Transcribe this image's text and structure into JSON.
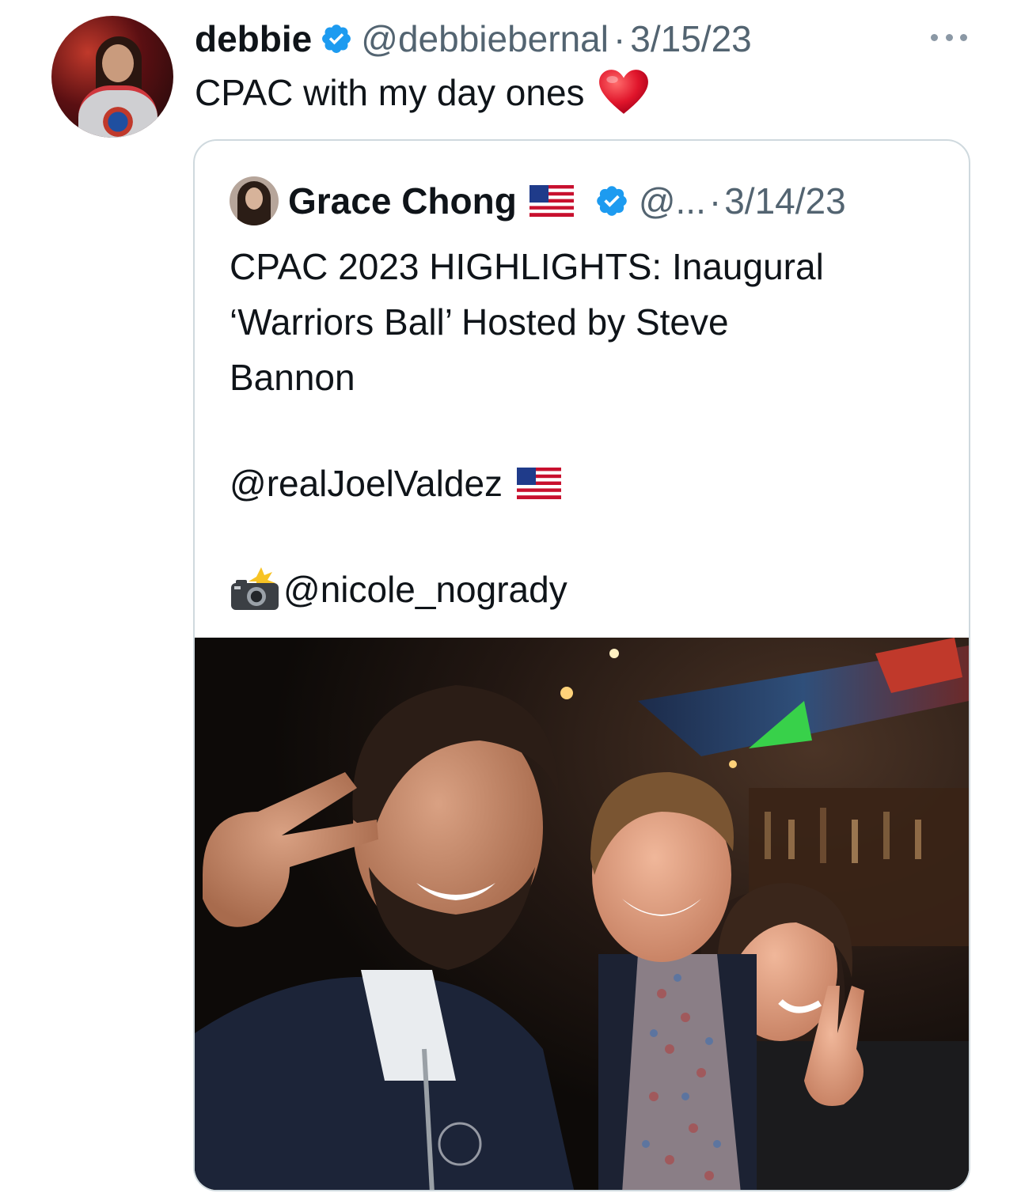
{
  "tweet": {
    "display_name": "debbie",
    "handle": "@debbiebernal",
    "separator": "·",
    "timestamp": "3/15/23",
    "text": "CPAC with my day ones",
    "emoji": "heart-icon",
    "verified": true,
    "more_menu": "more-options-icon"
  },
  "quoted_tweet": {
    "display_name": "Grace Chong",
    "name_emoji": "us-flag-icon",
    "verified": true,
    "handle": "@...",
    "separator": "·",
    "timestamp": "3/14/23",
    "body_lines": [
      "CPAC 2023 HIGHLIGHTS: Inaugural",
      "‘Warriors Ball’ Hosted by Steve",
      "Bannon"
    ],
    "mention_1": "@realJoelValdez",
    "mention_1_emoji": "us-flag-icon",
    "mention_2_emoji": "camera-flash-icon",
    "mention_2": "@nicole_nogrady",
    "media": "photo of three people smiling at a bar event"
  },
  "colors": {
    "text_primary": "#0f1419",
    "text_secondary": "#536471",
    "verified_blue": "#1d9bf0",
    "card_border": "#cfd9de",
    "heart_red": "#e0152b"
  }
}
